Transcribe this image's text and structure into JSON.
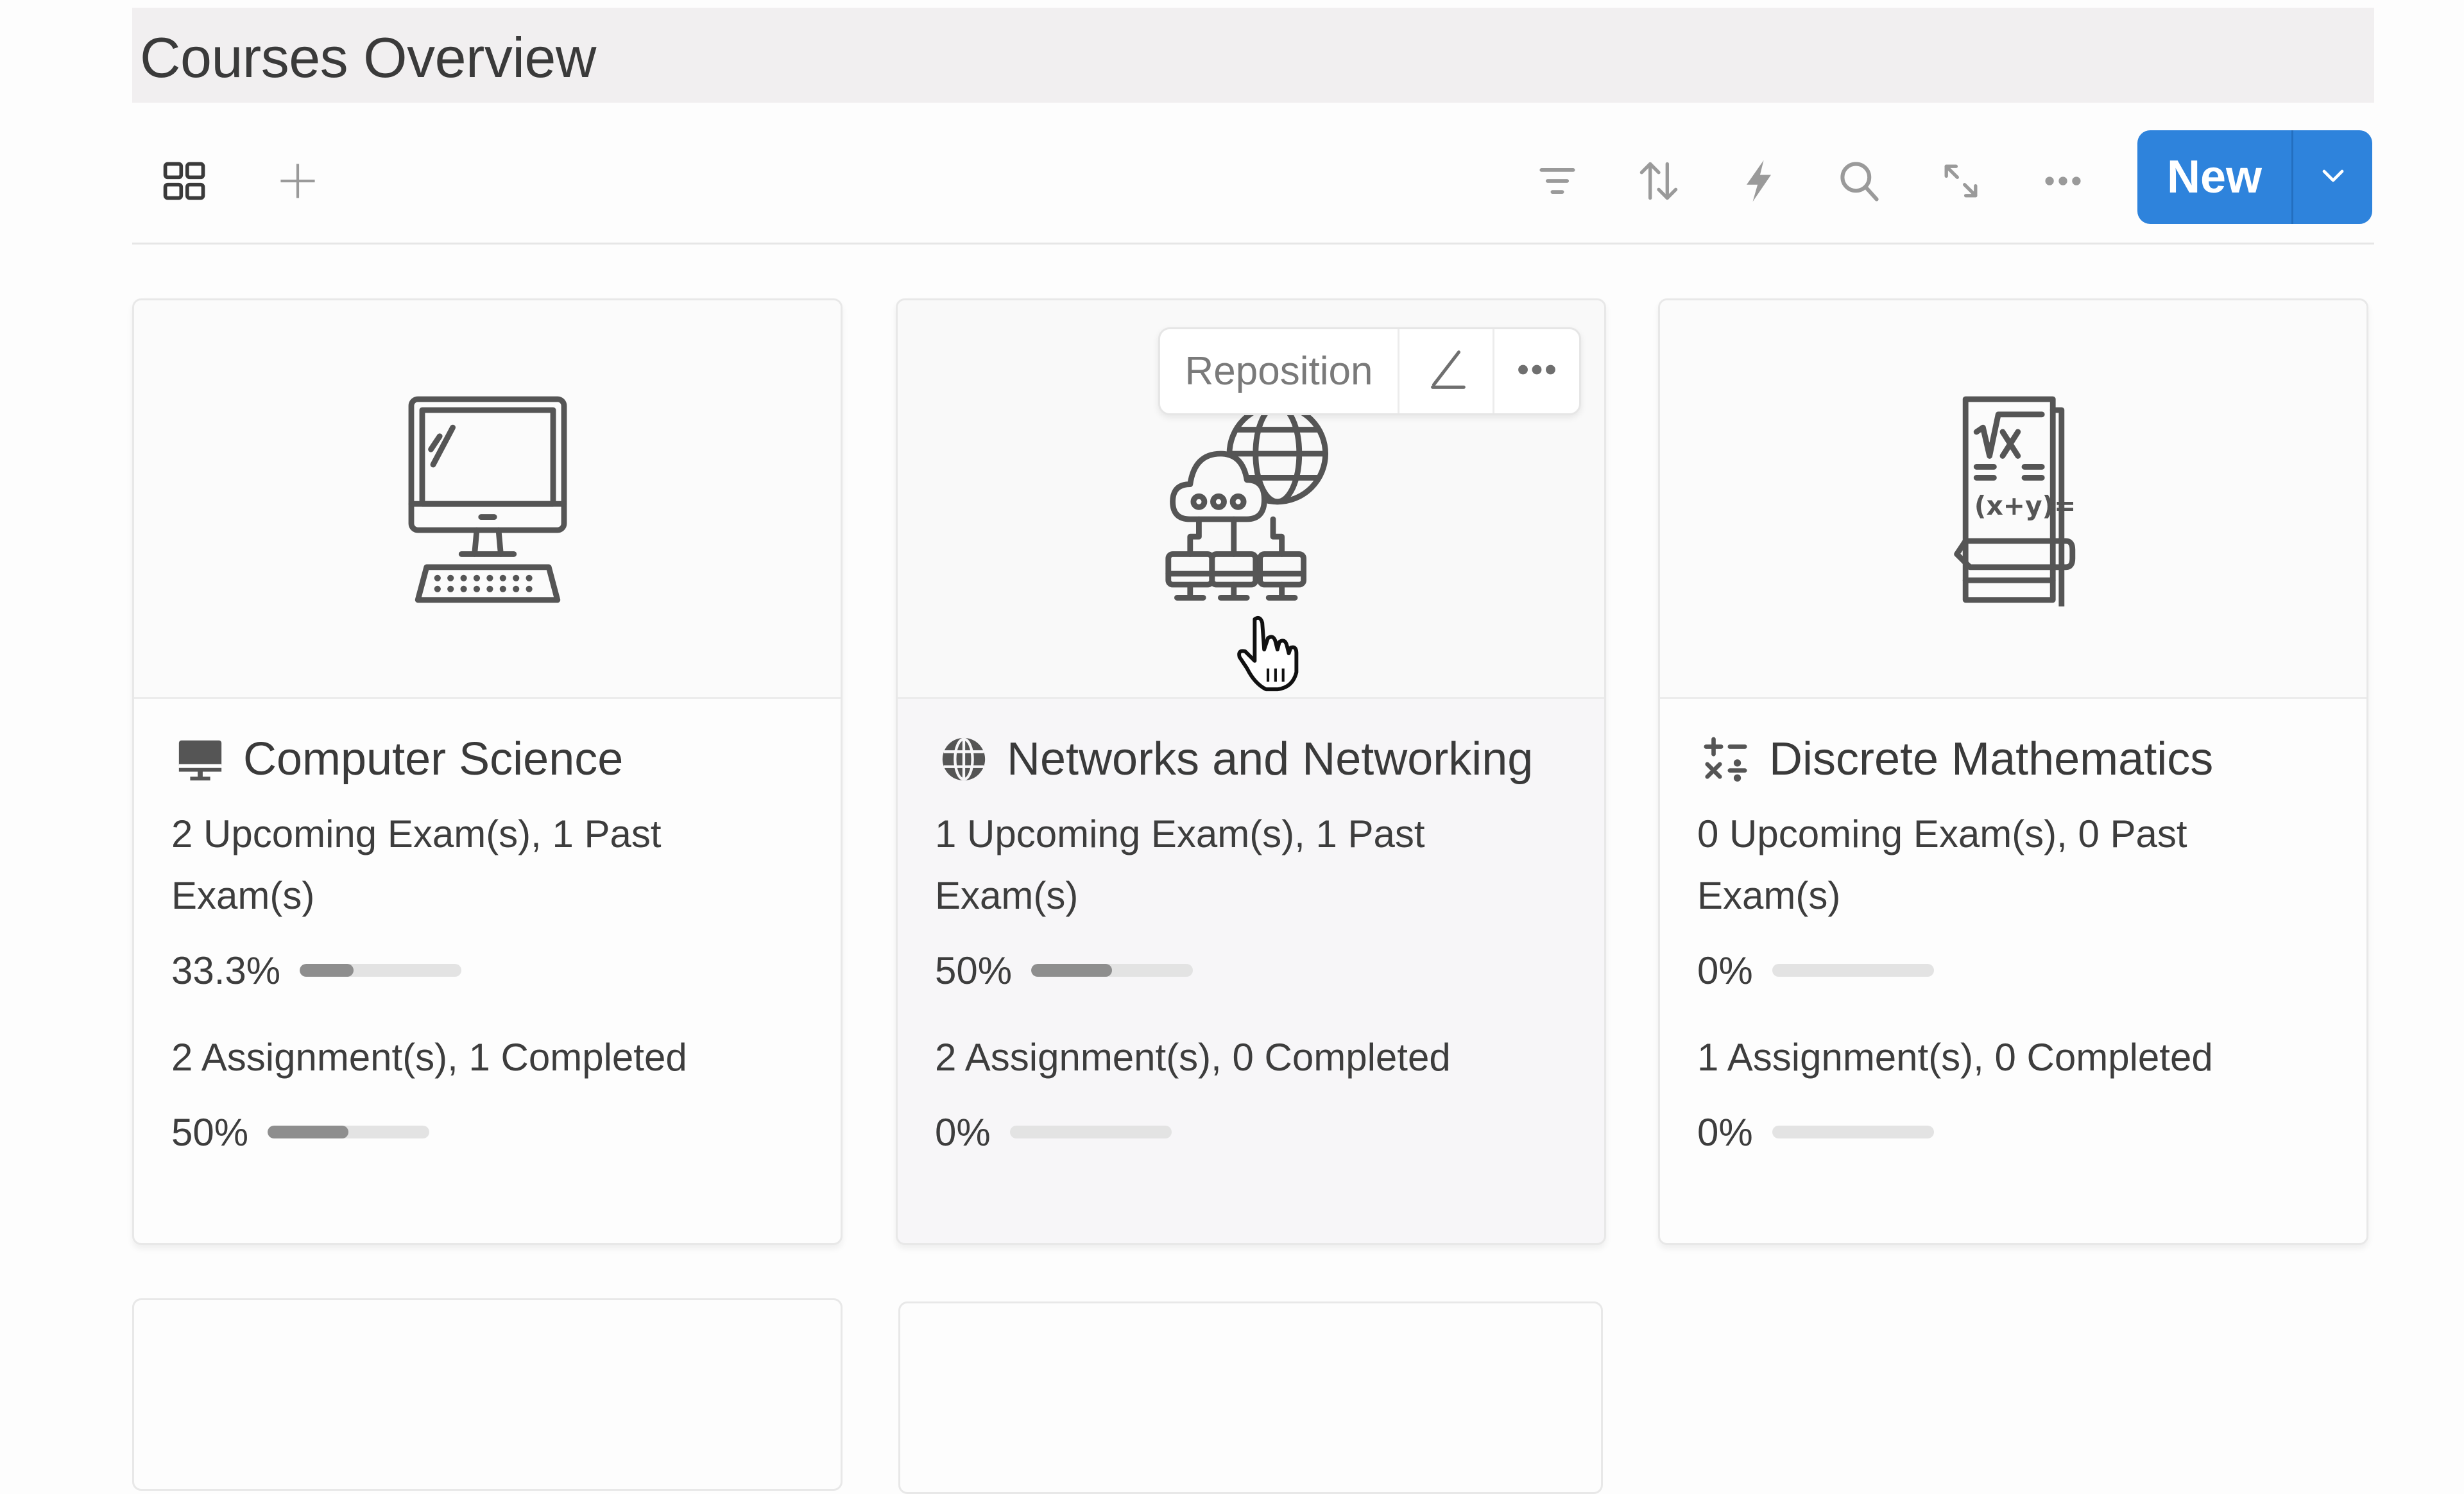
{
  "page": {
    "title": "Courses Overview"
  },
  "toolbar": {
    "left_icons": [
      "gallery-view-icon",
      "add-view-icon"
    ],
    "right_icons": [
      "filter-icon",
      "sort-icon",
      "automation-bolt-icon",
      "search-icon",
      "expand-icon",
      "more-icon"
    ],
    "new_label": "New",
    "new_dropdown_icon": "chevron-down-icon",
    "accent_color": "#2e83dc"
  },
  "cover_overlay": {
    "reposition_label": "Reposition",
    "edit_icon": "pencil-icon",
    "more_icon": "more-icon"
  },
  "cards": [
    {
      "title": "Computer Science",
      "title_icon": "desktop-computer-icon",
      "cover_icon": "computer-monitor-illustration",
      "exams_text": "2 Upcoming Exam(s), 1 Past Exam(s)",
      "exam_progress_label": "33.3%",
      "exam_progress": 0.333,
      "assignments_text": "2 Assignment(s), 1 Completed",
      "assignment_progress_label": "50%",
      "assignment_progress": 0.5
    },
    {
      "title": "Networks and Networking",
      "title_icon": "globe-icon",
      "cover_icon": "network-cloud-illustration",
      "exams_text": "1 Upcoming Exam(s), 1 Past Exam(s)",
      "exam_progress_label": "50%",
      "exam_progress": 0.5,
      "assignments_text": "2 Assignment(s), 0 Completed",
      "assignment_progress_label": "0%",
      "assignment_progress": 0
    },
    {
      "title": "Discrete Mathematics",
      "title_icon": "math-operators-icon",
      "cover_icon": "math-book-illustration",
      "exams_text": "0 Upcoming Exam(s), 0 Past Exam(s)",
      "exam_progress_label": "0%",
      "exam_progress": 0,
      "assignments_text": "1 Assignment(s), 0 Completed",
      "assignment_progress_label": "0%",
      "assignment_progress": 0
    }
  ]
}
